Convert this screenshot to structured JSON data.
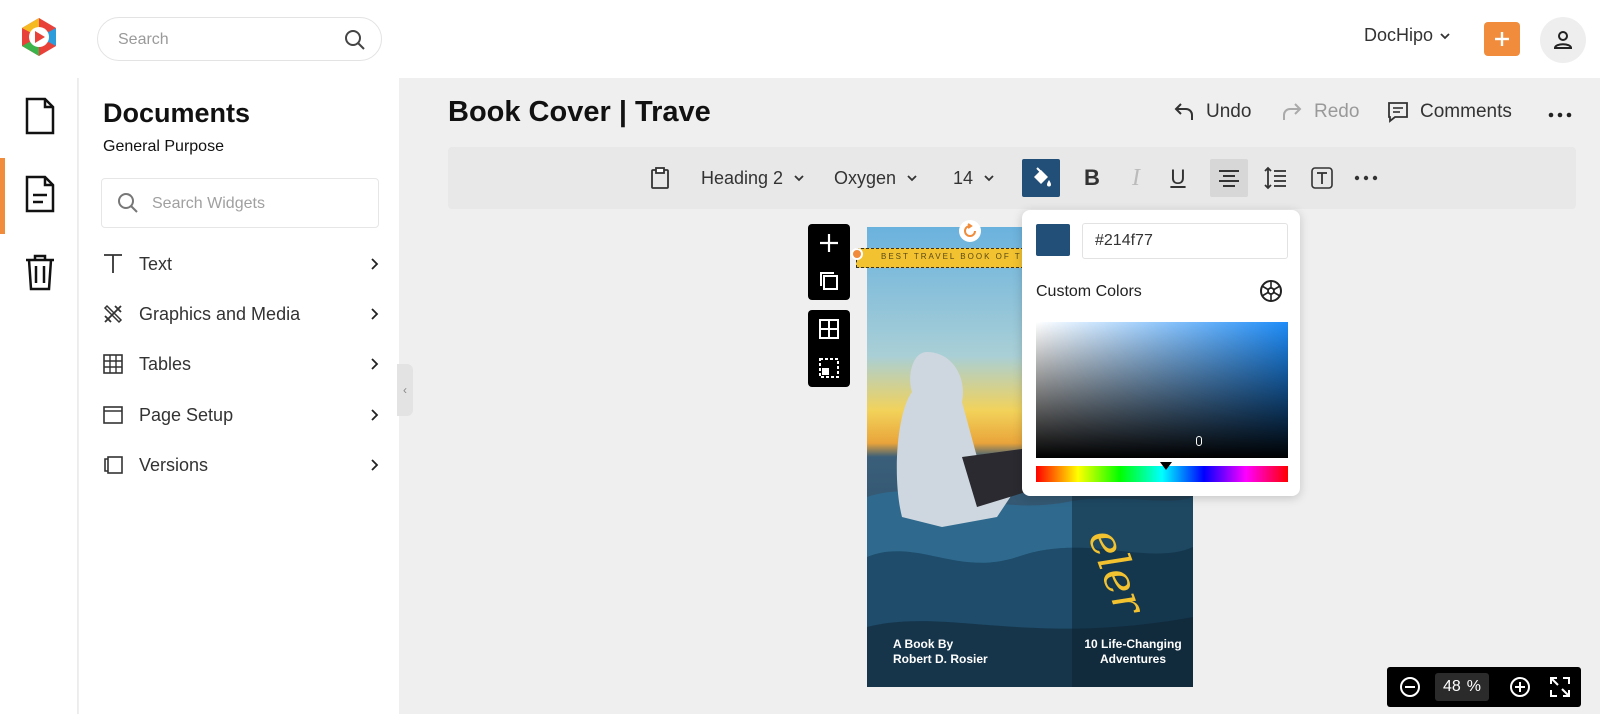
{
  "topbar": {
    "search_placeholder": "Search",
    "brand": "DocHipo"
  },
  "sidebar": {
    "title": "Documents",
    "subtitle": "General Purpose",
    "search_placeholder": "Search Widgets",
    "items": [
      {
        "label": "Text",
        "icon": "text-icon"
      },
      {
        "label": "Graphics and Media",
        "icon": "graphics-icon"
      },
      {
        "label": "Tables",
        "icon": "table-icon"
      },
      {
        "label": "Page Setup",
        "icon": "page-setup-icon"
      },
      {
        "label": "Versions",
        "icon": "versions-icon"
      }
    ]
  },
  "editor": {
    "doc_title": "Book Cover | Trave",
    "undo_label": "Undo",
    "redo_label": "Redo",
    "comments_label": "Comments"
  },
  "toolbar": {
    "heading": "Heading 2",
    "font": "Oxygen",
    "size": "14"
  },
  "cover": {
    "banner_text": "BEST TRAVEL BOOK OF TH",
    "author_line1": "A Book By",
    "author_line2": "Robert D. Rosier",
    "tag_line1": "10 Life-Changing",
    "tag_line2": "Adventures",
    "script_text": "eler"
  },
  "color_picker": {
    "hex_value": "#214f77",
    "custom_label": "Custom Colors",
    "selected_color": "#214f77"
  },
  "zoom": {
    "value": "48",
    "unit": "%"
  },
  "colors": {
    "accent": "#f08c3b",
    "fill_active": "#214f77"
  }
}
